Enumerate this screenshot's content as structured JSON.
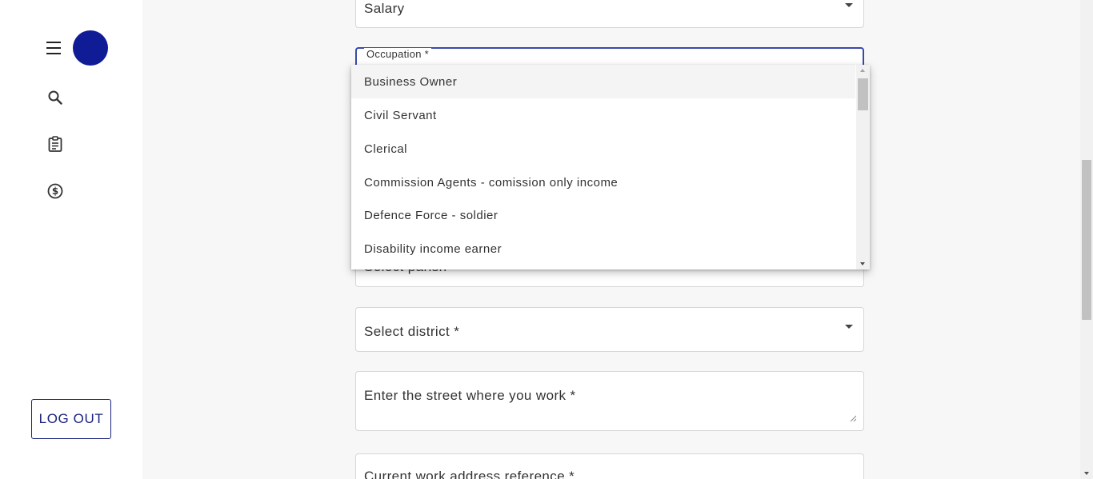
{
  "sidebar": {
    "menu_icon": "hamburger-menu-icon",
    "avatar_color": "#101b96",
    "nav_items": [
      {
        "icon": "search-icon"
      },
      {
        "icon": "clipboard-icon"
      },
      {
        "icon": "dollar-circle-icon"
      }
    ],
    "logout_label": "LOG OUT"
  },
  "form": {
    "income_type_value": "Salary",
    "occupation_label": "Occupation *",
    "parish_placeholder": "Select parish *",
    "district_placeholder": "Select district *",
    "street_placeholder": "Enter the street where you work *",
    "address_reference_placeholder": "Current work address reference *"
  },
  "occupation_dropdown": {
    "options": [
      "Business Owner",
      "Civil Servant",
      "Clerical",
      "Commission Agents - comission only income",
      "Defence Force - soldier",
      "Disability income earner"
    ]
  },
  "colors": {
    "accent": "#3949ab",
    "logout_text": "#1a237e"
  }
}
